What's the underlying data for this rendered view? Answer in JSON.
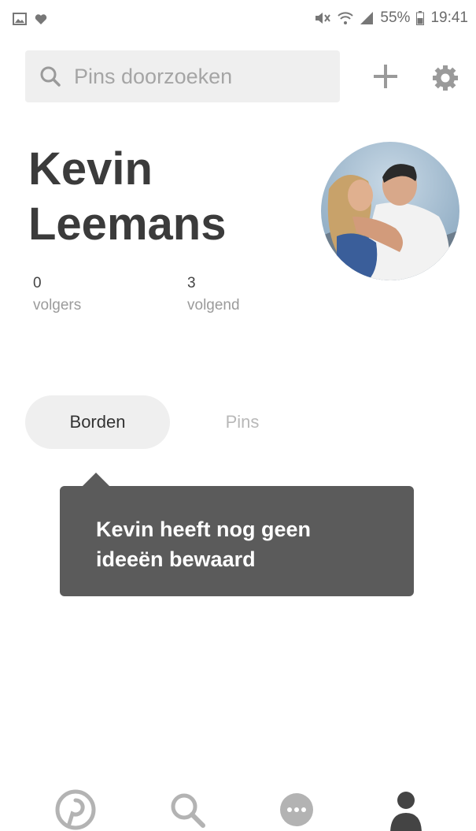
{
  "status_bar": {
    "battery_percent": "55%",
    "time": "19:41"
  },
  "search": {
    "placeholder": "Pins doorzoeken"
  },
  "profile": {
    "name_line1": "Kevin",
    "name_line2": "Leemans",
    "followers_count": "0",
    "followers_label": "volgers",
    "following_count": "3",
    "following_label": "volgend"
  },
  "tabs": [
    {
      "label": "Borden",
      "selected": true
    },
    {
      "label": "Pins",
      "selected": false
    }
  ],
  "tooltip": {
    "line1": "Kevin heeft nog geen",
    "line2": "ideeën bewaard"
  },
  "bottom_nav": [
    {
      "icon": "pinterest-icon",
      "active": false
    },
    {
      "icon": "search-icon",
      "active": false
    },
    {
      "icon": "messages-icon",
      "active": false
    },
    {
      "icon": "profile-icon",
      "active": true
    }
  ],
  "colors": {
    "tooltip_bg": "#5b5b5b",
    "tab_selected_bg": "#efefef",
    "nav_inactive": "#b3b3b3",
    "nav_active": "#444444"
  }
}
